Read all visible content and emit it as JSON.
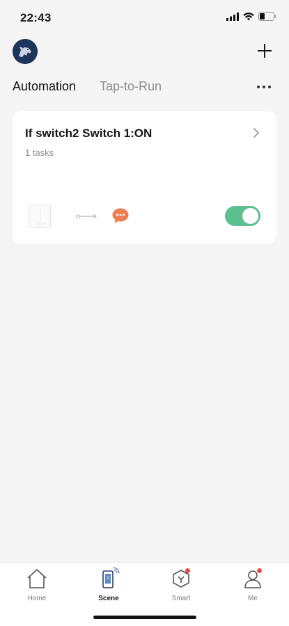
{
  "status_bar": {
    "time": "22:43"
  },
  "header": {
    "avatar": "avatar-image",
    "add_icon": "plus-icon"
  },
  "tabs": [
    {
      "label": "Automation",
      "active": true
    },
    {
      "label": "Tap-to-Run",
      "active": false
    }
  ],
  "more_icon": "more-horizontal-icon",
  "automation_cards": [
    {
      "title": "If switch2 Switch 1:ON",
      "subtitle": "1 tasks",
      "condition_icon": "switch-device-icon",
      "arrow_icon": "arrow-right-icon",
      "action_icon": "message-icon",
      "enabled": true
    }
  ],
  "colors": {
    "toggle_on": "#5cc08f",
    "message_icon": "#ec7e52",
    "badge": "#e84b4b"
  },
  "tabbar": [
    {
      "label": "Home",
      "icon": "home-icon",
      "active": false,
      "badge": false
    },
    {
      "label": "Scene",
      "icon": "scene-icon",
      "active": true,
      "badge": false
    },
    {
      "label": "Smart",
      "icon": "smart-icon",
      "active": false,
      "badge": true
    },
    {
      "label": "Me",
      "icon": "person-icon",
      "active": false,
      "badge": true
    }
  ]
}
